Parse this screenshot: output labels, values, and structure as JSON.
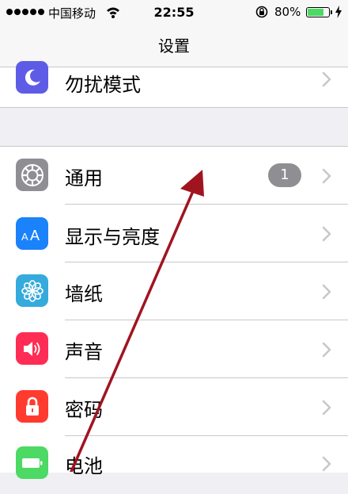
{
  "status_bar": {
    "carrier": "中国移动",
    "time": "22:55",
    "battery_percent": "80%",
    "battery_level": 0.8,
    "signal_dots": 5,
    "icons": [
      "signal-dots-icon",
      "wifi-icon",
      "rotation-lock-icon",
      "battery-icon",
      "charging-bolt-icon"
    ]
  },
  "nav": {
    "title": "设置"
  },
  "settings": {
    "items": [
      {
        "label": "勿扰模式",
        "icon": "moon-icon",
        "color": "#5e5ce6"
      },
      {
        "label": "通用",
        "icon": "gear-icon",
        "color": "#8e8e93",
        "badge": "1"
      },
      {
        "label": "显示与亮度",
        "icon": "text-size-icon",
        "color": "#1a82fb"
      },
      {
        "label": "墙纸",
        "icon": "flower-icon",
        "color": "#35aadc"
      },
      {
        "label": "声音",
        "icon": "speaker-icon",
        "color": "#ff2d55"
      },
      {
        "label": "密码",
        "icon": "lock-icon",
        "color": "#ff3b30"
      },
      {
        "label": "电池",
        "icon": "battery-icon",
        "color": "#4cd964"
      }
    ]
  },
  "annotation": {
    "icon": "red-arrow-icon",
    "color": "#a01420"
  },
  "colors": {
    "background": "#efeff4",
    "separator": "#c8c7cc",
    "chevron": "#c7c7cc",
    "badge": "#8e8e93"
  }
}
